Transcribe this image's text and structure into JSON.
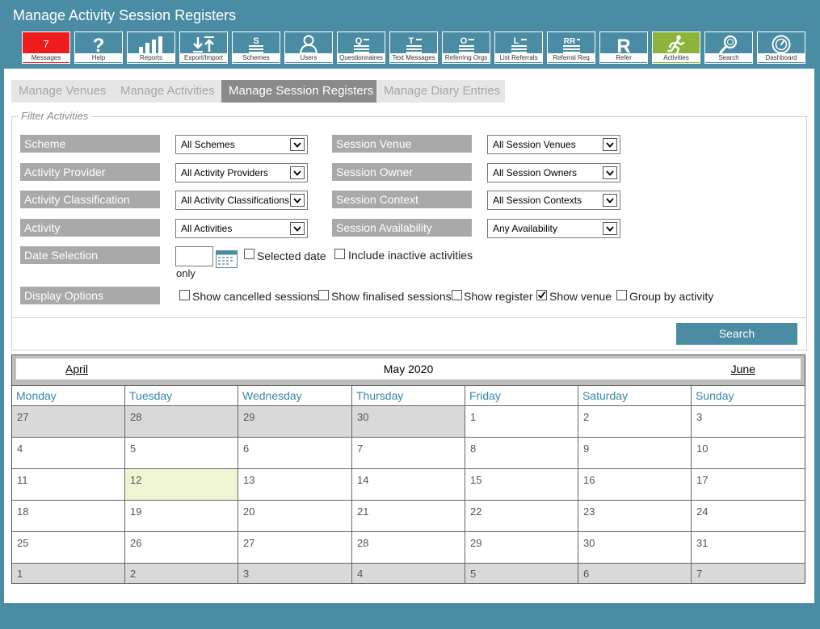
{
  "app": {
    "title": "Manage Activity Session Registers"
  },
  "toolbar": [
    {
      "label": "Messages",
      "icon": "messages-badge",
      "badge": "7"
    },
    {
      "label": "Help",
      "icon": "help-icon"
    },
    {
      "label": "Reports",
      "icon": "reports-icon"
    },
    {
      "label": "Export/Import",
      "icon": "export-import-icon"
    },
    {
      "label": "Schemes",
      "icon": "schemes-icon",
      "glyph": "S"
    },
    {
      "label": "Users",
      "icon": "users-icon"
    },
    {
      "label": "Questionnaires",
      "icon": "questionnaires-icon",
      "glyph": "Q"
    },
    {
      "label": "Text Messages",
      "icon": "text-messages-icon",
      "glyph": "T"
    },
    {
      "label": "Referring Orgs",
      "icon": "referring-orgs-icon",
      "glyph": "O"
    },
    {
      "label": "List Referrals",
      "icon": "list-referrals-icon",
      "glyph": "L"
    },
    {
      "label": "Referral Req",
      "icon": "referral-req-icon",
      "glyph": "RR"
    },
    {
      "label": "Refer",
      "icon": "refer-icon",
      "glyph": "R"
    },
    {
      "label": "Activities",
      "icon": "activities-icon"
    },
    {
      "label": "Search",
      "icon": "search-icon"
    },
    {
      "label": "Dashboard",
      "icon": "dashboard-icon"
    }
  ],
  "tabs": [
    "Manage Venues",
    "Manage Activities",
    "Manage Session Registers",
    "Manage Diary Entries"
  ],
  "active_tab": "Manage Session Registers",
  "filter": {
    "legend": "Filter Activities",
    "rows": [
      {
        "label": "Scheme",
        "value": "All Schemes",
        "label2": "Session Venue",
        "value2": "All Session Venues"
      },
      {
        "label": "Activity Provider",
        "value": "All Activity Providers",
        "label2": "Session Owner",
        "value2": "All Session Owners"
      },
      {
        "label": "Activity Classification",
        "value": "All Activity Classifications",
        "label2": "Session Context",
        "value2": "All Session Contexts"
      },
      {
        "label": "Activity",
        "value": "All Activities",
        "label2": "Session Availability",
        "value2": "Any Availability"
      }
    ],
    "date_selection": {
      "label": "Date Selection",
      "value": "",
      "selected_date_only_part1": "Selected date",
      "selected_date_only_part2": "only",
      "include_inactive": "Include inactive activities"
    },
    "display_options": {
      "label": "Display Options",
      "options": [
        {
          "label": "Show cancelled sessions",
          "checked": false
        },
        {
          "label": "Show finalised sessions",
          "checked": false
        },
        {
          "label": "Show register",
          "checked": false
        },
        {
          "label": "Show venue",
          "checked": true
        },
        {
          "label": "Group by activity",
          "checked": false
        }
      ]
    }
  },
  "search_button": "Search",
  "calendar": {
    "prev": "April",
    "month": "May 2020",
    "next": "June",
    "weekdays": [
      "Monday",
      "Tuesday",
      "Wednesday",
      "Thursday",
      "Friday",
      "Saturday",
      "Sunday"
    ],
    "weeks": [
      [
        "27",
        "28",
        "29",
        "30",
        "1",
        "2",
        "3"
      ],
      [
        "4",
        "5",
        "6",
        "7",
        "8",
        "9",
        "10"
      ],
      [
        "11",
        "12",
        "13",
        "14",
        "15",
        "16",
        "17"
      ],
      [
        "18",
        "19",
        "20",
        "21",
        "22",
        "23",
        "24"
      ],
      [
        "25",
        "26",
        "27",
        "28",
        "29",
        "30",
        "31"
      ],
      [
        "1",
        "2",
        "3",
        "4",
        "5",
        "6",
        "7"
      ]
    ],
    "other_month_cells": [
      [
        0,
        0
      ],
      [
        0,
        1
      ],
      [
        0,
        2
      ],
      [
        0,
        3
      ],
      [
        5,
        0
      ],
      [
        5,
        1
      ],
      [
        5,
        2
      ],
      [
        5,
        3
      ],
      [
        5,
        4
      ],
      [
        5,
        5
      ],
      [
        5,
        6
      ]
    ],
    "today_cell": [
      2,
      1
    ]
  },
  "colors": {
    "brand": "#4a8ca3",
    "alert": "#ee1c1c",
    "activities": "#8db33a",
    "today": "#eff5d2"
  }
}
